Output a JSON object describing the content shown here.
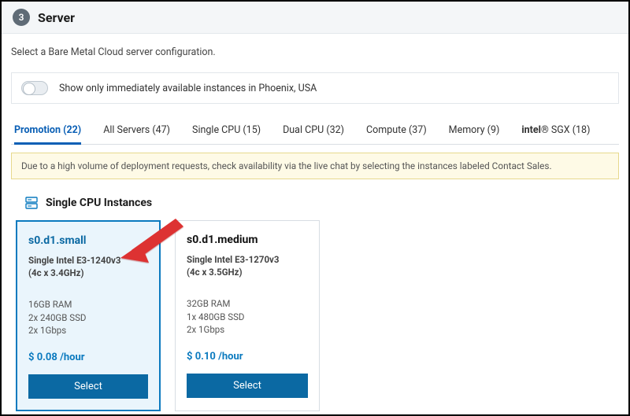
{
  "step": "3",
  "title": "Server",
  "intro": "Select a Bare Metal Cloud server configuration.",
  "toggle_label": "Show only immediately available instances in Phoenix, USA",
  "tabs": [
    {
      "label": "Promotion (22)"
    },
    {
      "label": "All Servers (47)"
    },
    {
      "label": "Single CPU (15)"
    },
    {
      "label": "Dual CPU (32)"
    },
    {
      "label": "Compute (37)"
    },
    {
      "label": "Memory (9)"
    },
    {
      "brand_prefix": "intel",
      "brand_reg": "®",
      "brand_model": " SGX",
      "count": " (18)"
    }
  ],
  "notice": "Due to a high volume of deployment requests, check availability via the live chat by selecting the instances labeled Contact Sales.",
  "section_title": "Single CPU Instances",
  "cards": [
    {
      "name": "s0.d1.small",
      "cpu_line1": "Single Intel E3-1240v3",
      "cpu_line2": "(4c x 3.4GHz)",
      "spec1": "16GB RAM",
      "spec2": "2x 240GB SSD",
      "spec3": "2x 1Gbps",
      "price": "$ 0.08 /hour",
      "button": "Select"
    },
    {
      "name": "s0.d1.medium",
      "cpu_line1": "Single Intel E3-1270v3",
      "cpu_line2": "(4c x 3.5GHz)",
      "spec1": "32GB RAM",
      "spec2": "1x 480GB SSD",
      "spec3": "2x 1Gbps",
      "price": "$ 0.10 /hour",
      "button": "Select"
    }
  ]
}
